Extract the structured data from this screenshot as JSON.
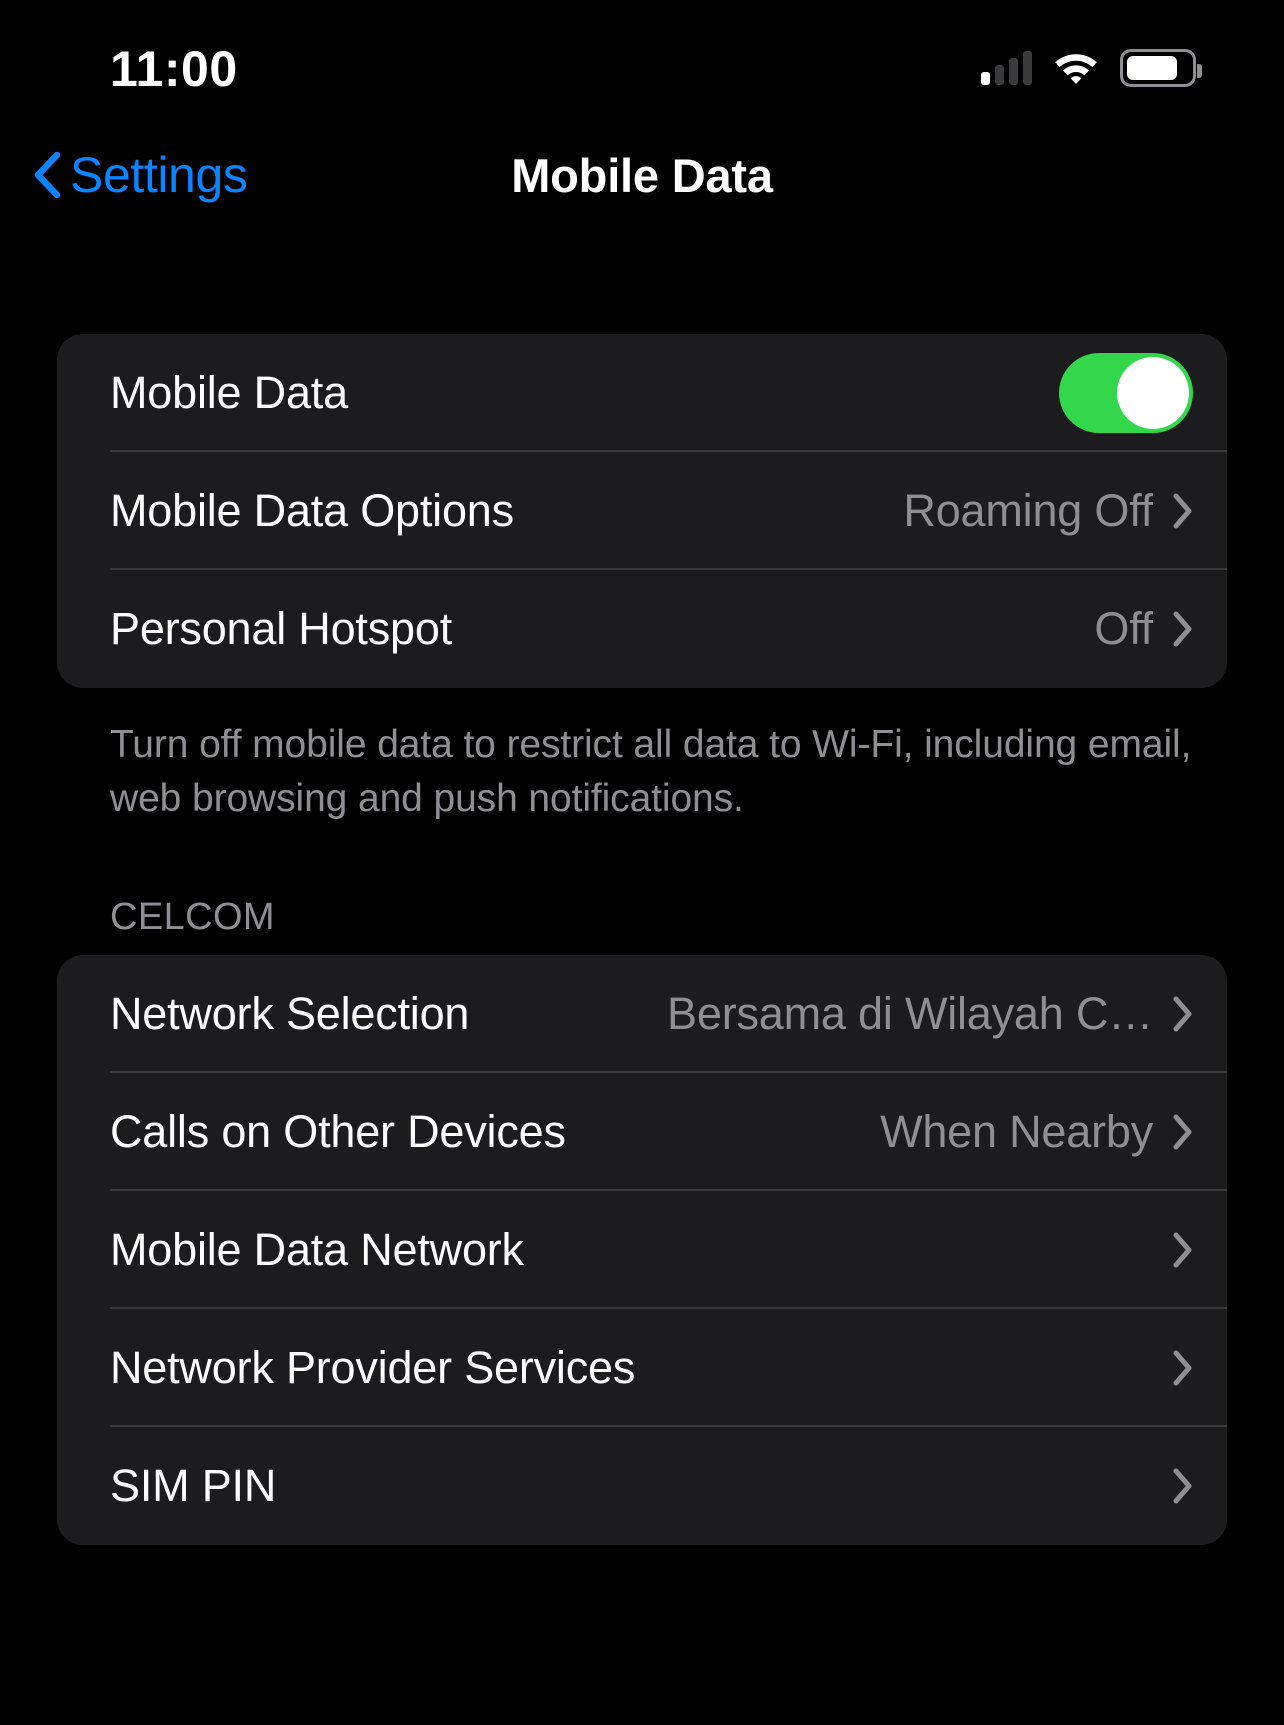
{
  "status_bar": {
    "time": "11:00",
    "cellular_icon": "cellular-signal-icon",
    "cellular_bars_filled": 1,
    "cellular_bars_total": 4,
    "wifi_icon": "wifi-icon",
    "battery_icon": "battery-icon",
    "battery_level_percent": 72
  },
  "nav": {
    "back_label": "Settings",
    "back_icon": "chevron-left-icon",
    "title": "Mobile Data"
  },
  "colors": {
    "accent_blue": "#0a84ff",
    "toggle_on_green": "#32d74b",
    "card_background": "#1c1c1e",
    "page_background": "#000000",
    "secondary_text": "#8e8e93",
    "separator": "#3a3a3c"
  },
  "sections": [
    {
      "header": "",
      "rows": [
        {
          "label": "Mobile Data",
          "control": "toggle",
          "toggle_state": "on",
          "value": "",
          "chevron": false
        },
        {
          "label": "Mobile Data Options",
          "control": "disclosure",
          "value": "Roaming Off",
          "chevron": true
        },
        {
          "label": "Personal Hotspot",
          "control": "disclosure",
          "value": "Off",
          "chevron": true
        }
      ],
      "footer": "Turn off mobile data to restrict all data to Wi-Fi, including email, web browsing and push notifications."
    },
    {
      "header": "CELCOM",
      "rows": [
        {
          "label": "Network Selection",
          "control": "disclosure",
          "value": "Bersama di Wilayah C…",
          "chevron": true
        },
        {
          "label": "Calls on Other Devices",
          "control": "disclosure",
          "value": "When Nearby",
          "chevron": true
        },
        {
          "label": "Mobile Data Network",
          "control": "disclosure",
          "value": "",
          "chevron": true
        },
        {
          "label": "Network Provider Services",
          "control": "disclosure",
          "value": "",
          "chevron": true
        },
        {
          "label": "SIM PIN",
          "control": "disclosure",
          "value": "",
          "chevron": true
        }
      ],
      "footer": ""
    }
  ]
}
